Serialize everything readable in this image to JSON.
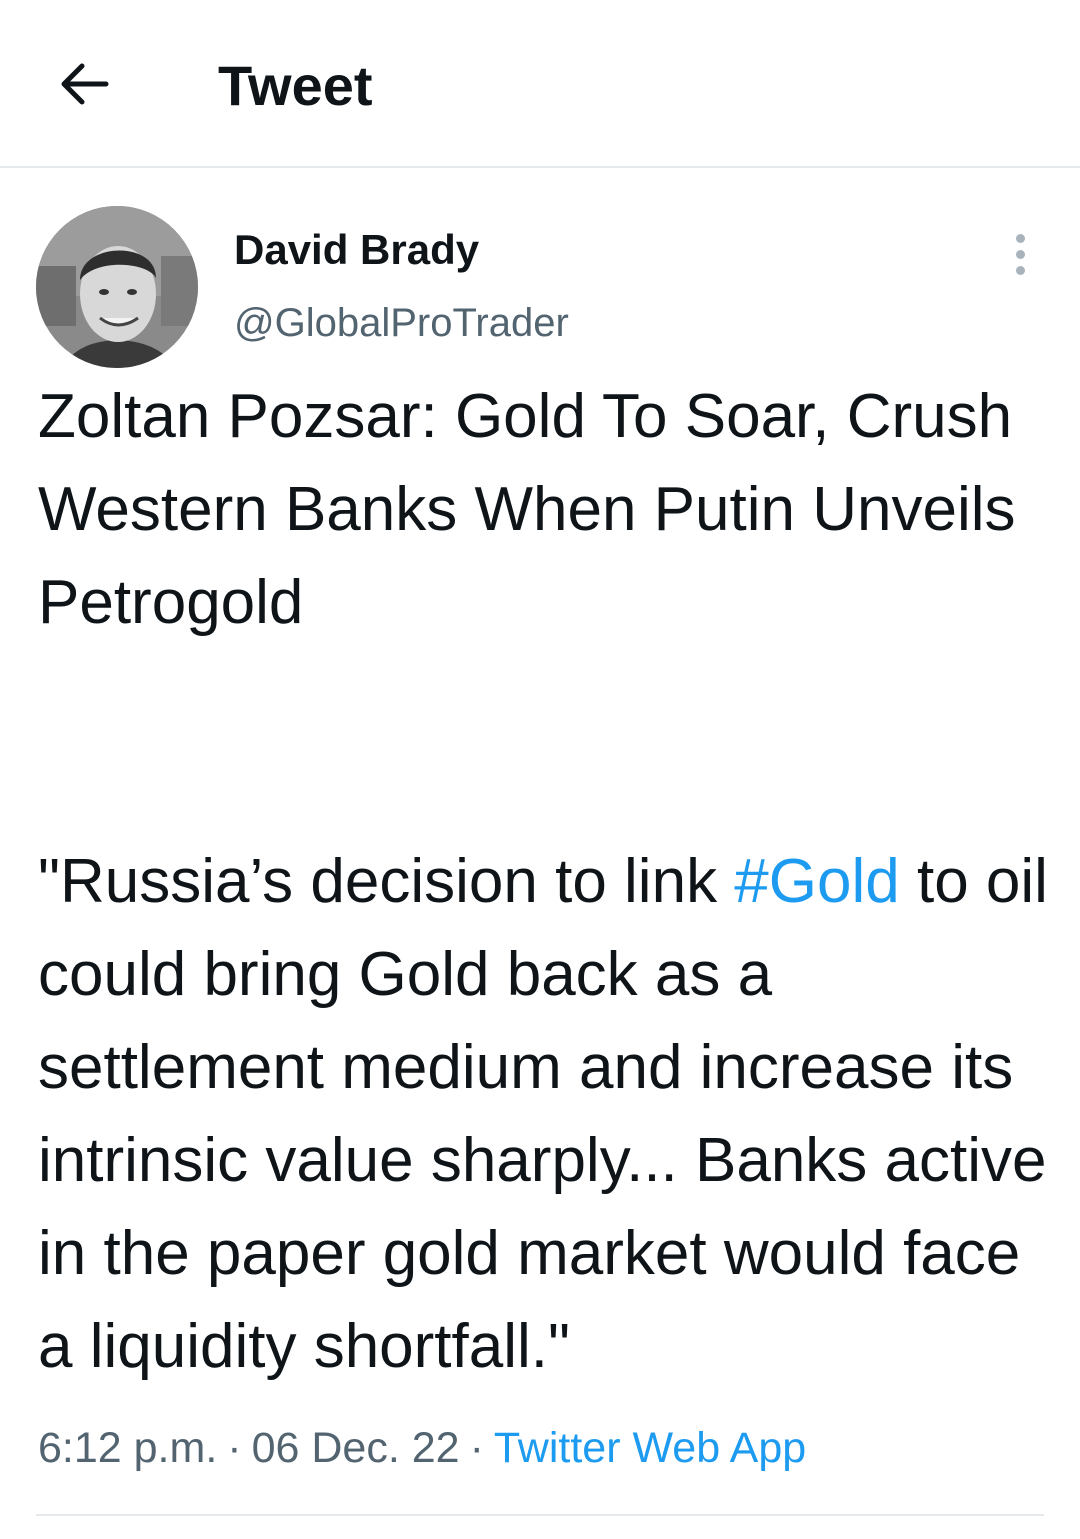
{
  "header": {
    "back_icon": "arrow-left-icon",
    "title": "Tweet"
  },
  "author": {
    "name": "David Brady",
    "handle": "@GlobalProTrader",
    "more_icon": "more-vertical-icon"
  },
  "tweet": {
    "headline": "Zoltan Pozsar: Gold To Soar, Crush Western Banks When Putin Unveils Petrogold",
    "quote_part1": "\"Russia’s decision to link ",
    "hashtag": "#Gold",
    "quote_part2": " to oil could bring Gold back as a settlement medium and increase its intrinsic value sharply... Banks active in the paper gold market would face a liquidity shortfall.\""
  },
  "meta": {
    "time": "6:12 p.m.",
    "separator": "·",
    "date": "06 Dec. 22",
    "source": "Twitter Web App"
  },
  "colors": {
    "link": "#1d9bf0",
    "secondary_text": "#536471",
    "primary_text": "#0f1419"
  }
}
